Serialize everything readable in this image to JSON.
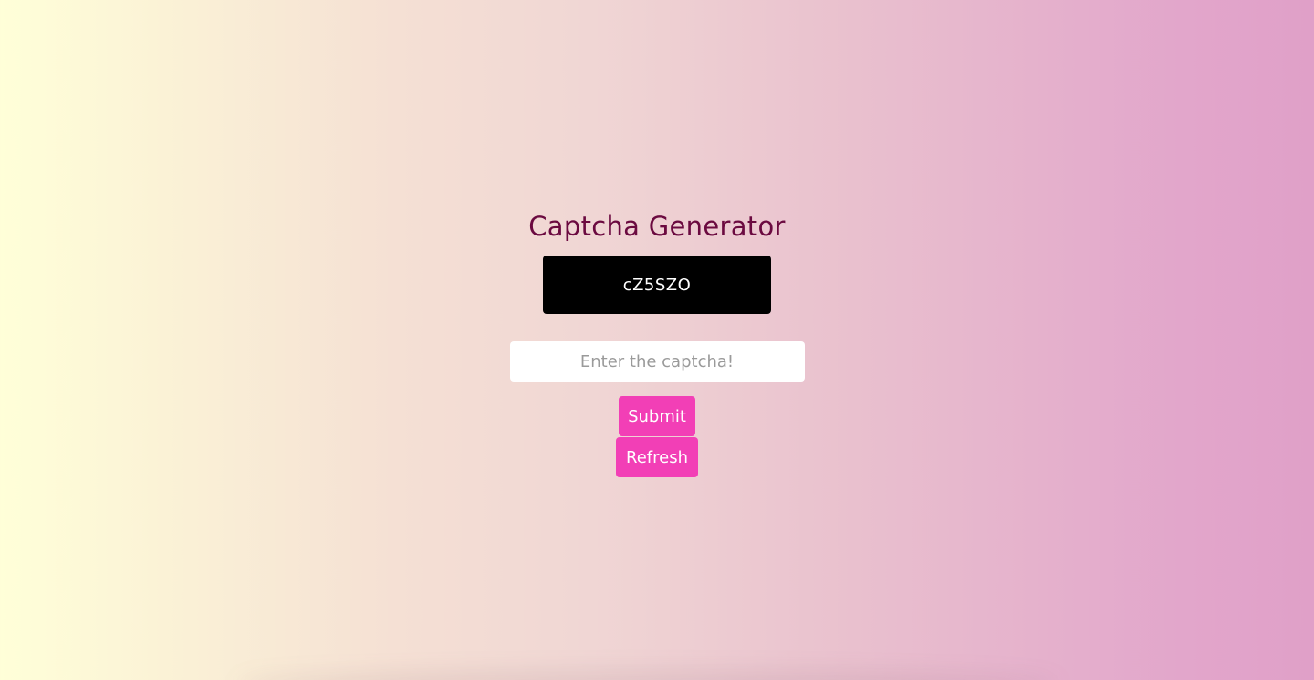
{
  "page": {
    "title": "Captcha Generator"
  },
  "captcha": {
    "code": "cZ5SZO"
  },
  "input": {
    "placeholder": "Enter the captcha!",
    "value": ""
  },
  "buttons": {
    "submit_label": "Submit",
    "refresh_label": "Refresh"
  },
  "colors": {
    "title": "#6b0a40",
    "button": "#f23fb6",
    "captcha_bg": "#000000",
    "gradient_start": "#ffffd8",
    "gradient_end": "#e0a0c8"
  }
}
